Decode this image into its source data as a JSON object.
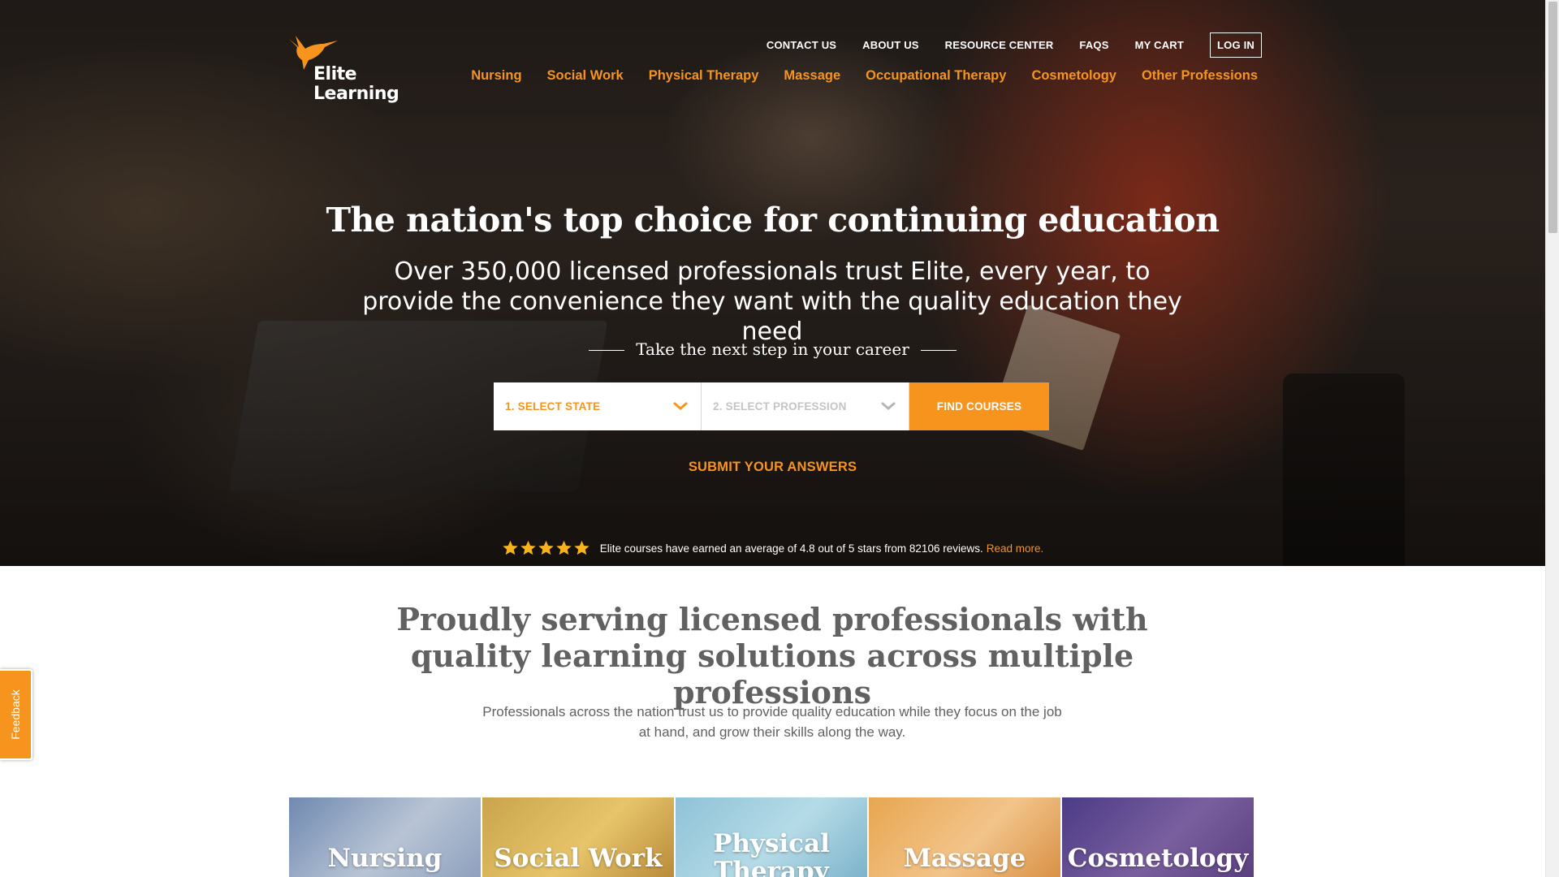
{
  "colors": {
    "accent": "#f7941d",
    "heading_gray": "#616161",
    "white": "#ffffff"
  },
  "logo": {
    "line1": "Elite",
    "line2": "Learning",
    "icon": "hummingbird-icon"
  },
  "utility_nav": {
    "contact": "CONTACT US",
    "about": "ABOUT US",
    "resource": "RESOURCE CENTER",
    "faqs": "FAQS",
    "cart": "MY CART",
    "login": "LOG IN"
  },
  "main_nav": [
    {
      "label": "Nursing"
    },
    {
      "label": "Social Work"
    },
    {
      "label": "Physical Therapy"
    },
    {
      "label": "Massage"
    },
    {
      "label": "Occupational Therapy"
    },
    {
      "label": "Cosmetology"
    },
    {
      "label": "Other Professions"
    }
  ],
  "hero": {
    "title": "The nation's top choice for continuing education",
    "subtitle": "Over 350,000 licensed professionals trust Elite, every year, to provide the convenience they want with the quality education they need",
    "tagline": "Take the next step in your career"
  },
  "finder": {
    "state_label": "1. SELECT STATE",
    "profession_label": "2. SELECT PROFESSION",
    "find_button": "FIND COURSES",
    "submit_link": "SUBMIT YOUR ANSWERS"
  },
  "reviews": {
    "star_count": 5,
    "text": "Elite courses have earned an average of 4.8 out of 5 stars from 82106 reviews.",
    "read_more": "Read more."
  },
  "serving": {
    "title": "Proudly serving licensed professionals with quality learning solutions across multiple professions",
    "description": "Professionals across the nation trust us to provide quality education while they focus on the job at hand, and grow their skills along the way."
  },
  "tiles": [
    {
      "label": "Nursing"
    },
    {
      "label": "Social Work"
    },
    {
      "label": "Physical Therapy"
    },
    {
      "label": "Massage"
    },
    {
      "label": "Cosmetology"
    }
  ],
  "feedback": {
    "label": "Feedback"
  }
}
